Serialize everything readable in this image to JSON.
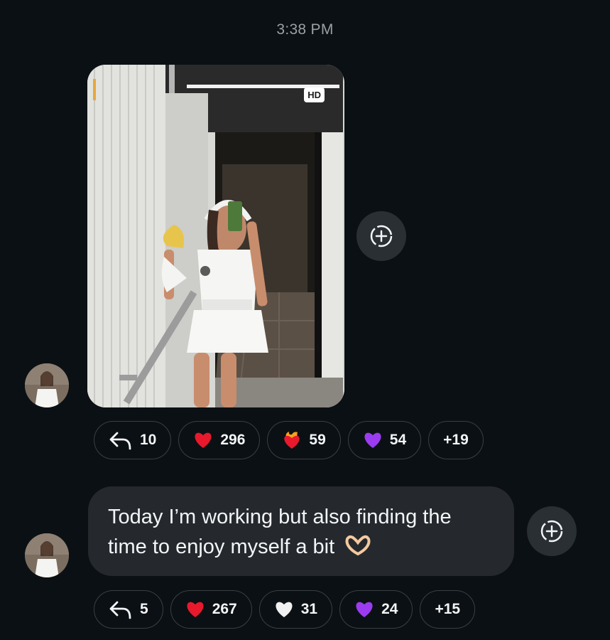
{
  "timestamp": "3:38 PM",
  "photo_message": {
    "badge": "HD",
    "reactions": [
      {
        "icon": "reply-icon",
        "count": "10"
      },
      {
        "icon": "red-heart-icon",
        "count": "296",
        "color": "#e8192c"
      },
      {
        "icon": "heart-on-fire-icon",
        "count": "59",
        "color": "#f04a2d"
      },
      {
        "icon": "purple-heart-icon",
        "count": "54",
        "color": "#9b3cf0"
      },
      {
        "icon": "more-reactions",
        "count": "+19"
      }
    ]
  },
  "text_message": {
    "text": "Today I’m working but also finding the time to enjoy myself a bit",
    "emoji_icon": "heart-hands-icon",
    "reactions": [
      {
        "icon": "reply-icon",
        "count": "5"
      },
      {
        "icon": "red-heart-icon",
        "count": "267",
        "color": "#e8192c"
      },
      {
        "icon": "white-heart-icon",
        "count": "31",
        "color": "#f0f0f0"
      },
      {
        "icon": "purple-heart-icon",
        "count": "24",
        "color": "#9b3cf0"
      },
      {
        "icon": "more-reactions",
        "count": "+15"
      }
    ]
  }
}
